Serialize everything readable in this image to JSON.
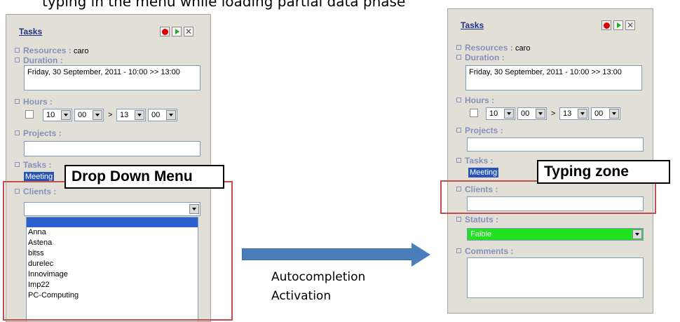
{
  "intro_fragment": "typing in the menu while loading partial data phase",
  "left_panel": {
    "title": "Tasks",
    "resources_label": "Resources :",
    "resources_value": "caro",
    "duration_label": "Duration :",
    "duration_value": "Friday, 30 September, 2011 - 10:00 >> 13:00",
    "hours_label": "Hours :",
    "hour_from": "10",
    "min_from": "00",
    "sep": ">",
    "hour_to": "13",
    "min_to": "00",
    "projects_label": "Projects :",
    "tasks_label": "Tasks :",
    "tasks_value": "Meeting",
    "clients_label": "Clients :",
    "client_options": [
      "Anna",
      "Astena",
      "bitss",
      "durelec",
      "Innovimage",
      "Imp22",
      "PC-Computing"
    ]
  },
  "right_panel": {
    "title": "Tasks",
    "resources_label": "Resources :",
    "resources_value": "caro",
    "duration_label": "Duration :",
    "duration_value": "Friday, 30 September, 2011 - 10:00 >> 13:00",
    "hours_label": "Hours :",
    "hour_from": "10",
    "min_from": "00",
    "sep": ">",
    "hour_to": "13",
    "min_to": "00",
    "projects_label": "Projects :",
    "tasks_label": "Tasks :",
    "tasks_value": "Meeting",
    "clients_label": "Clients :",
    "statuts_label": "Statuts :",
    "statuts_value": "Faible",
    "comments_label": "Comments :"
  },
  "callouts": {
    "left": "Drop Down Menu",
    "right": "Typing zone"
  },
  "arrow_caption": {
    "line1": "Autocompletion",
    "line2": "Activation"
  },
  "colors": {
    "panel_bg": "#e1dfd6",
    "label_color": "#8791bd",
    "highlight": "#c0504d",
    "arrow": "#4a7ebb",
    "status_green": "#22e022"
  }
}
